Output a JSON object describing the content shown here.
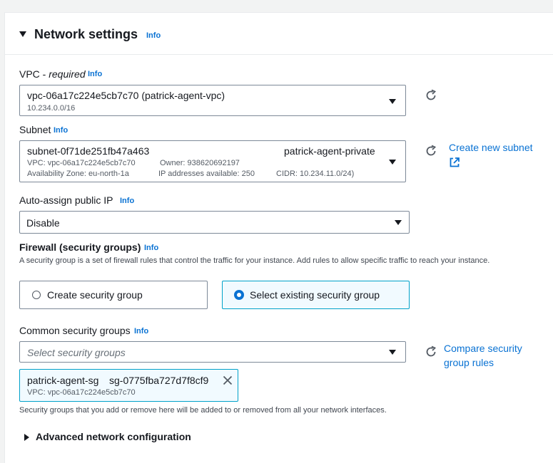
{
  "section": {
    "title": "Network settings",
    "info_label": "Info"
  },
  "vpc": {
    "label": "VPC - ",
    "required_label": "required",
    "info_label": "Info",
    "value": "vpc-06a17c224e5cb7c70 (patrick-agent-vpc)",
    "cidr": "10.234.0.0/16"
  },
  "subnet": {
    "label": "Subnet",
    "info_label": "Info",
    "id": "subnet-0f71de251fb47a463",
    "name": "patrick-agent-private",
    "vpc": "VPC: vpc-06a17c224e5cb7c70",
    "owner": "Owner: 938620692197",
    "az": "Availability Zone: eu-north-1a",
    "ips": "IP addresses available: 250",
    "cidr": "CIDR: 10.234.11.0/24)",
    "create_link": "Create new subnet"
  },
  "public_ip": {
    "label": "Auto-assign public IP",
    "info_label": "Info",
    "value": "Disable"
  },
  "firewall": {
    "label": "Firewall (security groups)",
    "info_label": "Info",
    "description": "A security group is a set of firewall rules that control the traffic for your instance. Add rules to allow specific traffic to reach your instance.",
    "option_create": "Create security group",
    "option_select": "Select existing security group",
    "selected": "select"
  },
  "common_sg": {
    "label": "Common security groups",
    "info_label": "Info",
    "placeholder": "Select security groups",
    "compare_link": "Compare security group rules",
    "token": {
      "name": "patrick-agent-sg",
      "id": "sg-0775fba727d7f8cf9",
      "vpc": "VPC: vpc-06a17c224e5cb7c70"
    },
    "note": "Security groups that you add or remove here will be added to or removed from all your network interfaces."
  },
  "advanced": {
    "label": "Advanced network configuration"
  },
  "colors": {
    "link": "#0972d3",
    "selected_bg": "#f1faff",
    "selected_border": "#00a1c9",
    "border": "#7d8998"
  },
  "icons": [
    "caret-down-icon",
    "info-link",
    "refresh-icon",
    "external-link-icon",
    "dropdown-arrow-icon",
    "close-icon",
    "caret-right-icon"
  ]
}
